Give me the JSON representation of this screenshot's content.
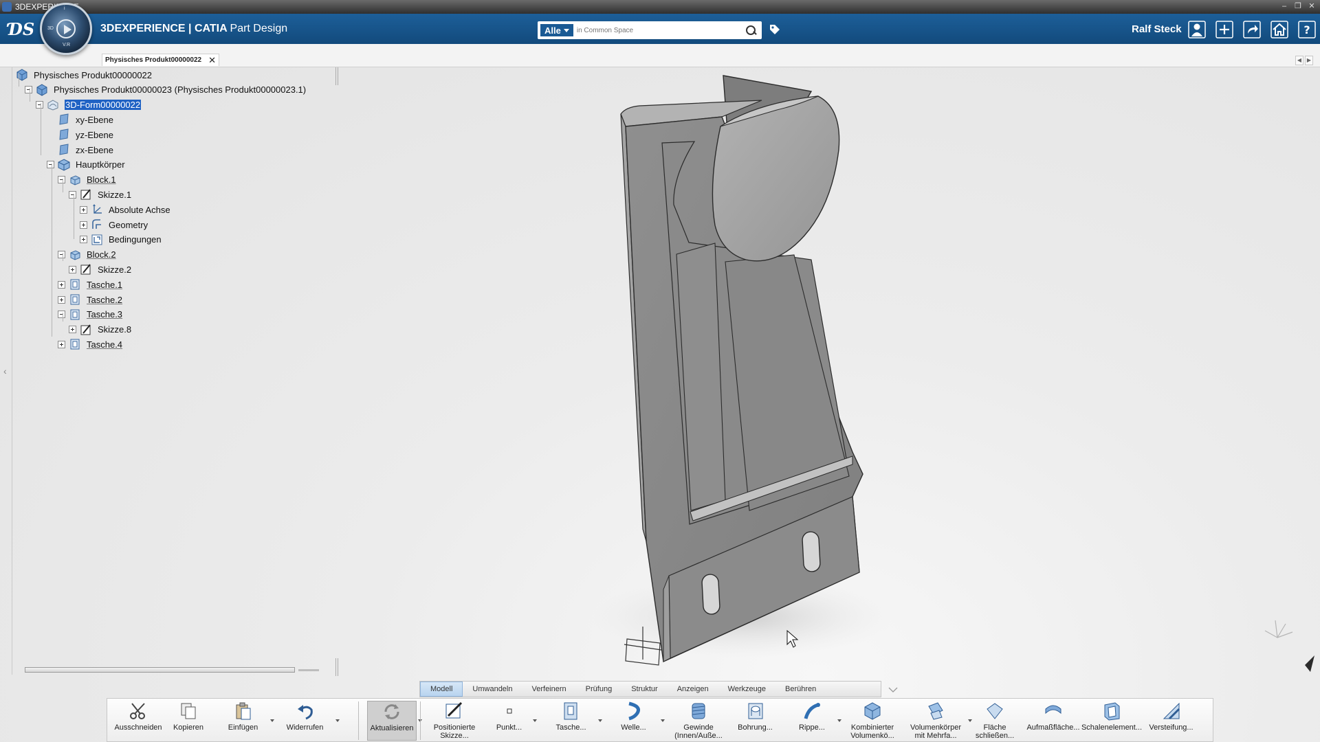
{
  "os_window": {
    "title": "3DEXPERIENCE",
    "controls": [
      "–",
      "❐",
      "✕"
    ]
  },
  "top_bar": {
    "brand": "3DEXPERIENCE | CATIA",
    "app_name": "Part Design",
    "compass_labels": {
      "top": "i",
      "left": "3D",
      "bottom": "V.R"
    },
    "search": {
      "scope": "Alle",
      "placeholder": "in Common Space"
    },
    "user": "Ralf Steck"
  },
  "tabs": [
    {
      "label": "Physisches Produkt00000022",
      "close": "✕"
    }
  ],
  "tab_arrows": [
    "◀",
    "▶"
  ],
  "tree": [
    {
      "label": "Physisches Produkt00000022",
      "icon": "product-icon",
      "depth": 0,
      "expander": "none"
    },
    {
      "label": "Physisches Produkt00000023 (Physisches Produkt00000023.1)",
      "icon": "product-icon",
      "depth": 1,
      "expander": "minus"
    },
    {
      "label": "3D-Form00000022",
      "icon": "shape-icon",
      "depth": 2,
      "expander": "minus",
      "selected": true
    },
    {
      "label": "xy-Ebene",
      "icon": "plane-icon",
      "depth": 3,
      "expander": "none"
    },
    {
      "label": "yz-Ebene",
      "icon": "plane-icon",
      "depth": 3,
      "expander": "none"
    },
    {
      "label": "zx-Ebene",
      "icon": "plane-icon",
      "depth": 3,
      "expander": "none"
    },
    {
      "label": "Hauptkörper",
      "icon": "body-icon",
      "depth": 3,
      "expander": "minus"
    },
    {
      "label": "Block.1",
      "icon": "pad-icon",
      "depth": 4,
      "expander": "minus",
      "link": true
    },
    {
      "label": "Skizze.1",
      "icon": "sketch-icon",
      "depth": 5,
      "expander": "minus"
    },
    {
      "label": "Absolute Achse",
      "icon": "axis-icon",
      "depth": 6,
      "expander": "plus"
    },
    {
      "label": "Geometry",
      "icon": "geometry-icon",
      "depth": 6,
      "expander": "plus"
    },
    {
      "label": "Bedingungen",
      "icon": "constraints-icon",
      "depth": 6,
      "expander": "plus"
    },
    {
      "label": "Block.2",
      "icon": "pad-icon",
      "depth": 4,
      "expander": "minus",
      "link": true
    },
    {
      "label": "Skizze.2",
      "icon": "sketch-icon",
      "depth": 5,
      "expander": "plus"
    },
    {
      "label": "Tasche.1",
      "icon": "pocket-icon",
      "depth": 4,
      "expander": "plus",
      "link": true
    },
    {
      "label": "Tasche.2",
      "icon": "pocket-icon",
      "depth": 4,
      "expander": "plus",
      "link": true
    },
    {
      "label": "Tasche.3",
      "icon": "pocket-icon",
      "depth": 4,
      "expander": "minus",
      "link": true
    },
    {
      "label": "Skizze.8",
      "icon": "sketch-icon",
      "depth": 5,
      "expander": "plus"
    },
    {
      "label": "Tasche.4",
      "icon": "pocket-icon",
      "depth": 4,
      "expander": "plus",
      "link": true
    }
  ],
  "command_tabs": [
    {
      "label": "Modell",
      "active": true
    },
    {
      "label": "Umwandeln"
    },
    {
      "label": "Verfeinern"
    },
    {
      "label": "Prüfung"
    },
    {
      "label": "Struktur"
    },
    {
      "label": "Anzeigen"
    },
    {
      "label": "Werkzeuge"
    },
    {
      "label": "Berühren"
    }
  ],
  "toolbar": [
    {
      "label": "Ausschneiden",
      "icon": "scissors-icon"
    },
    {
      "label": "Kopieren",
      "icon": "copy-icon"
    },
    {
      "label": "Einfügen",
      "icon": "paste-icon",
      "dropdown": true
    },
    {
      "label": "Widerrufen",
      "icon": "undo-icon",
      "dropdown": true
    },
    {
      "label": "Aktualisieren",
      "icon": "update-icon",
      "pressed": true,
      "dropdown": true
    },
    {
      "label": "Positionierte\nSkizze...",
      "icon": "positioned-sketch-icon"
    },
    {
      "label": "Punkt...",
      "icon": "point-icon",
      "dropdown": true
    },
    {
      "label": "Tasche...",
      "icon": "pocket-tool-icon",
      "dropdown": true
    },
    {
      "label": "Welle...",
      "icon": "shaft-icon",
      "dropdown": true
    },
    {
      "label": "Gewinde\n(Innen/Auße...",
      "icon": "thread-icon"
    },
    {
      "label": "Bohrung...",
      "icon": "hole-icon"
    },
    {
      "label": "Rippe...",
      "icon": "rib-icon",
      "dropdown": true
    },
    {
      "label": "Kombinierter\nVolumenkö...",
      "icon": "combined-solid-icon"
    },
    {
      "label": "Volumenkörper\nmit Mehrfa...",
      "icon": "multi-section-solid-icon",
      "dropdown": true
    },
    {
      "label": "Fläche\nschließen...",
      "icon": "close-surface-icon"
    },
    {
      "label": "Aufmaßfläche...",
      "icon": "thick-surface-icon"
    },
    {
      "label": "Schalenelement...",
      "icon": "shell-icon"
    },
    {
      "label": "Versteifung...",
      "icon": "stiffener-icon"
    }
  ],
  "colors": {
    "topbar": "#1a5a94",
    "selection": "#1f62c4",
    "model_gray": "#8e8e8e"
  }
}
